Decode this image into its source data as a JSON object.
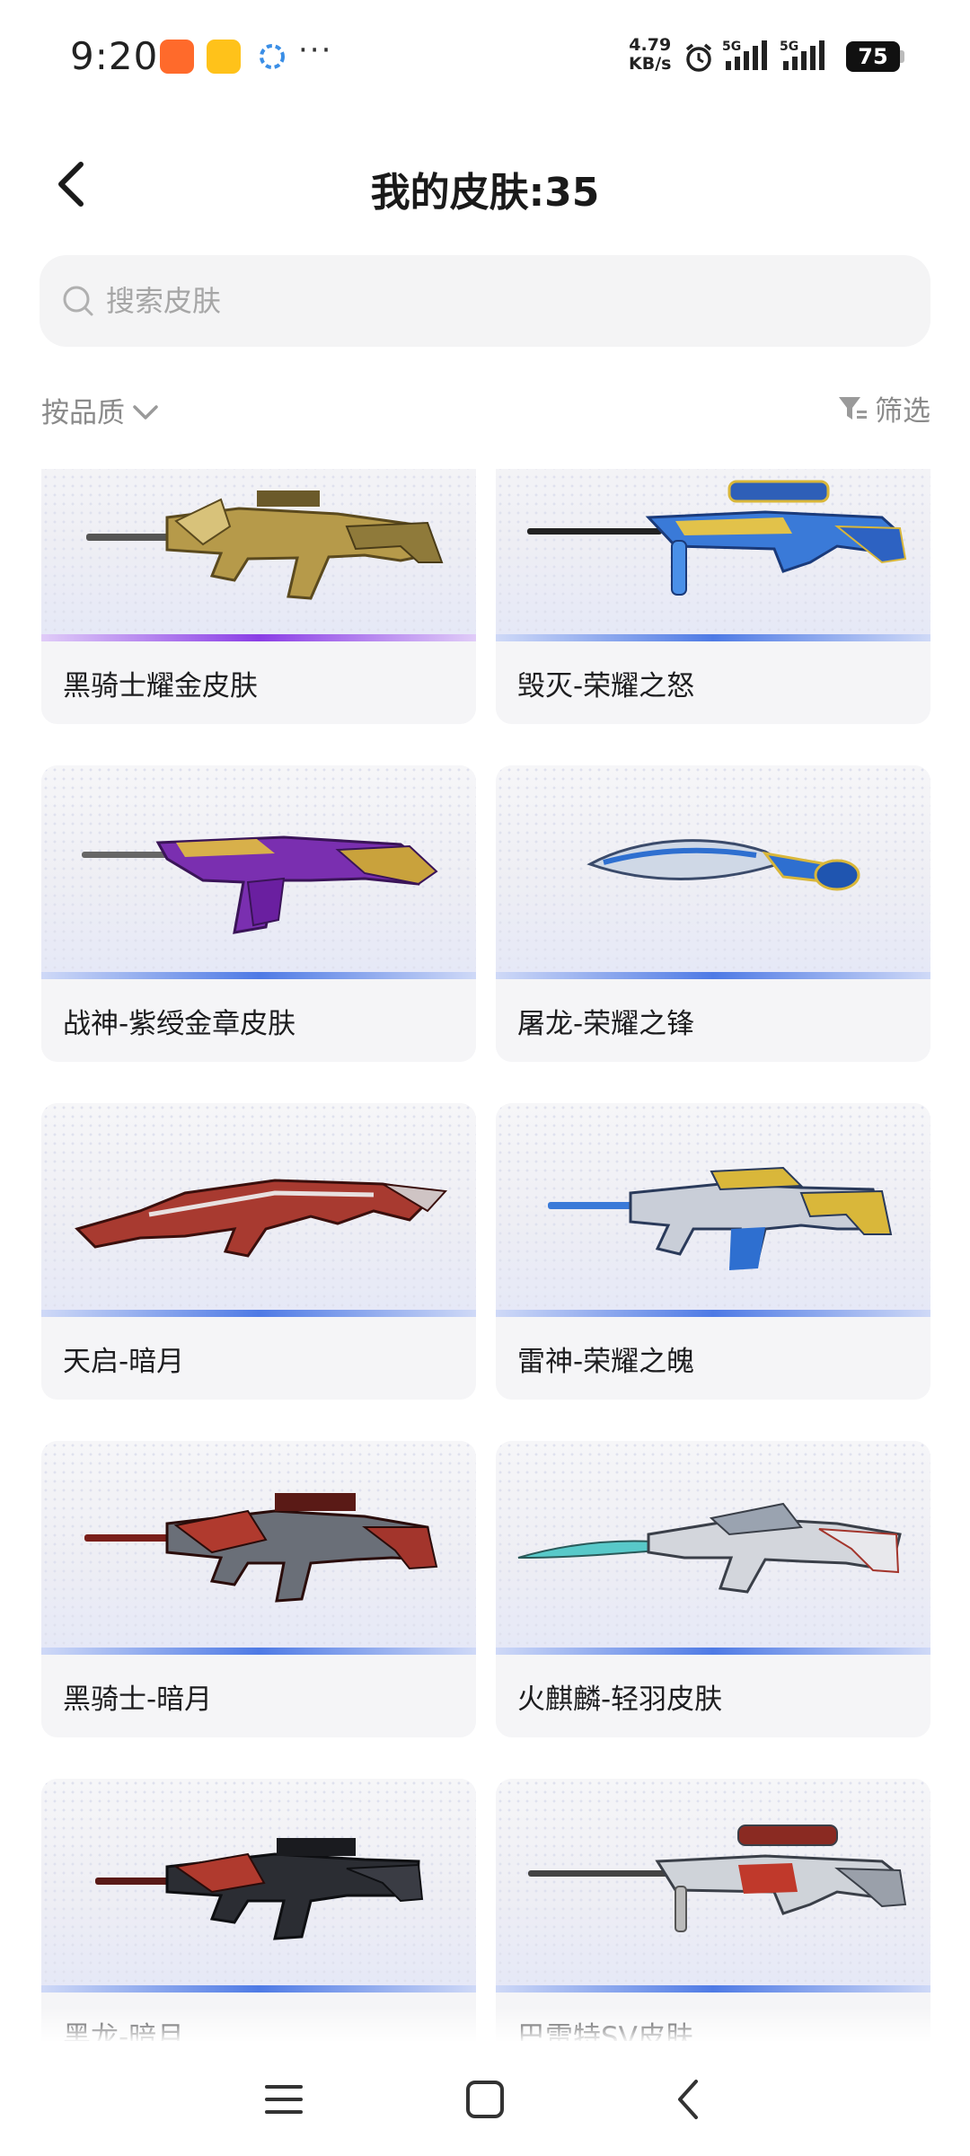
{
  "status_bar": {
    "time": "9:20",
    "net_speed_value": "4.79",
    "net_speed_unit": "KB/s",
    "signal_1_label": "5G",
    "signal_2_label": "5G",
    "battery": "75",
    "more": "···"
  },
  "header": {
    "title": "我的皮肤:35"
  },
  "search": {
    "placeholder": "搜索皮肤"
  },
  "toolbar": {
    "sort_label": "按品质",
    "filter_label": "筛选"
  },
  "skins": [
    {
      "name": "黑骑士耀金皮肤",
      "quality": "purple",
      "icon": "rifle-gold"
    },
    {
      "name": "毁灭-荣耀之怒",
      "quality": "blue",
      "icon": "sniper-blue-gold"
    },
    {
      "name": "战神-紫绶金章皮肤",
      "quality": "blue",
      "icon": "ak-purple-gold"
    },
    {
      "name": "屠龙-荣耀之锋",
      "quality": "blue",
      "icon": "knife-blue-gold"
    },
    {
      "name": "天启-暗月",
      "quality": "blue",
      "icon": "rifle-red-dark"
    },
    {
      "name": "雷神-荣耀之魄",
      "quality": "blue",
      "icon": "rifle-blue-gold"
    },
    {
      "name": "黑骑士-暗月",
      "quality": "blue",
      "icon": "rifle-red-dark"
    },
    {
      "name": "火麒麟-轻羽皮肤",
      "quality": "blue",
      "icon": "ak-silver"
    },
    {
      "name": "黑龙-暗月",
      "quality": "blue",
      "icon": "rifle-red-dark"
    },
    {
      "name": "巴雷特SV皮肤",
      "quality": "blue",
      "icon": "sniper-red-silver"
    }
  ],
  "colors": {
    "quality_blue": "#4e7ae5",
    "quality_purple": "#8a3de6",
    "text_secondary": "#8a8a8a"
  },
  "nav": {
    "menu_icon": "menu-icon",
    "home_icon": "home-icon",
    "back_icon": "back-icon"
  }
}
